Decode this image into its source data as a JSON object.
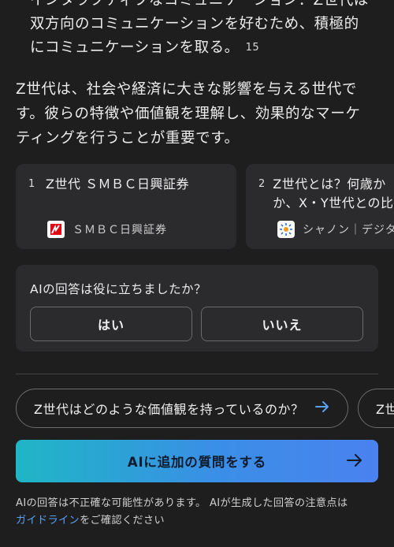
{
  "answer": {
    "partial_lines": [
      "インタラクティブなコミュニケーション：Z世代は",
      "双方向のコミュニケーションを好むため、積極的",
      "にコミュニケーションを取る。"
    ],
    "citation": "15"
  },
  "summary": {
    "lines": [
      "Z世代は、社会や経済に大きな影響を与える世代で",
      "す。彼らの特徴や価値観を理解し、効果的なマーケ",
      "ティングを行うことが重要です。"
    ]
  },
  "sources": [
    {
      "number": "1",
      "title_lines": [
        "Z世代 ＳＭＢＣ日興証券"
      ],
      "site": "ＳＭＢＣ日興証券",
      "favicon": "smbc-logo-icon"
    },
    {
      "number": "2",
      "title_lines": [
        "Z世代とは？何歳か",
        "か、X・Y世代との比"
      ],
      "site": "シャノン｜デジタル",
      "favicon": "shannon-logo-icon"
    }
  ],
  "feedback": {
    "question": "AIの回答は役に立ちましたか？",
    "yes_label": "はい",
    "no_label": "いいえ"
  },
  "suggestions": [
    {
      "label": "Z世代はどのような価値観を持っているのか？"
    },
    {
      "label": "Z世"
    }
  ],
  "ask_button": {
    "label": "AIに追加の質問をする"
  },
  "disclaimer": {
    "line1": "AIの回答は不正確な可能性があります。 AIが生成した回答の注意点は",
    "link": "ガイドライン",
    "line2_rest": "をご確認ください"
  },
  "colors": {
    "background": "#1e1e1f",
    "card": "#2b2b2d",
    "link": "#5aa0f5",
    "accent_start": "#1fb6c5",
    "accent_end": "#4a82f0"
  }
}
